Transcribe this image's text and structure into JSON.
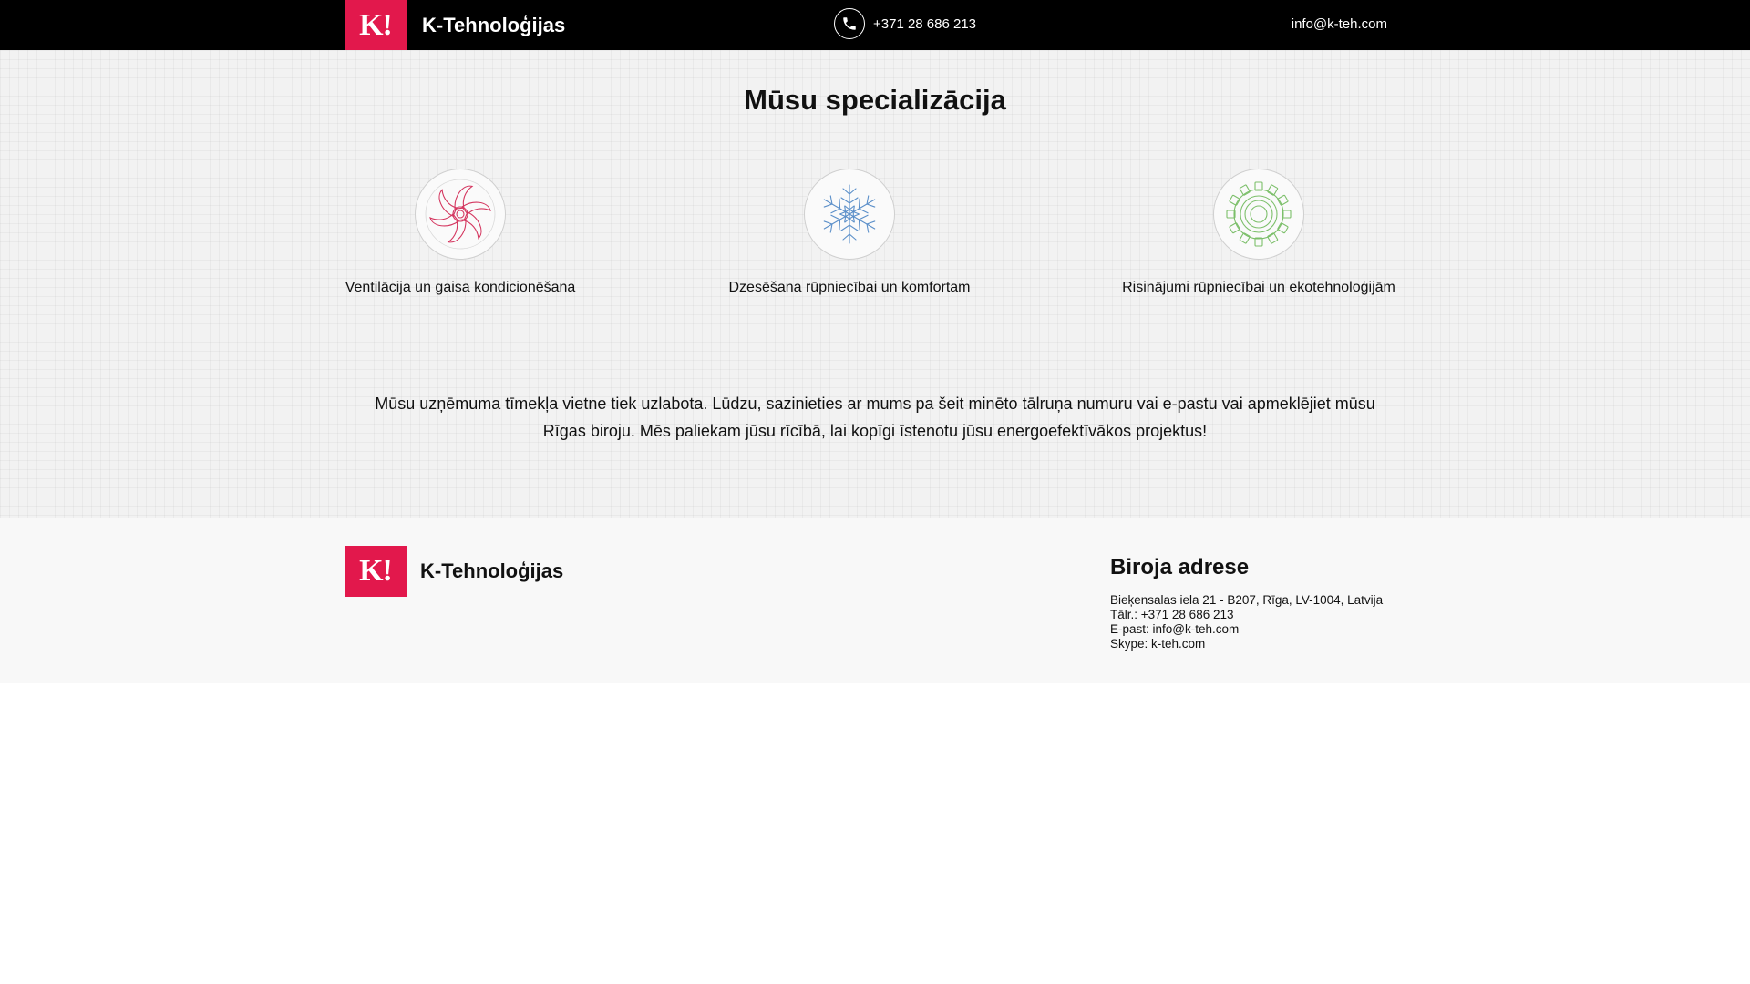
{
  "header": {
    "logo_text": "K!",
    "brand": "K-Tehnoloģijas",
    "phone": "+371 28 686 213",
    "email": "info@k-teh.com"
  },
  "main": {
    "title": "Mūsu specializācija",
    "specializations": [
      {
        "label": "Ventilācija un gaisa kondicionēšana",
        "icon": "fan-icon",
        "color": "#d4365f"
      },
      {
        "label": "Dzesēšana rūpniecībai un komfortam",
        "icon": "snowflake-icon",
        "color": "#5b8fc9"
      },
      {
        "label": "Risinājumi rūpniecībai un ekotehnoloģijām",
        "icon": "gear-icon",
        "color": "#7cbf6a"
      }
    ],
    "intro": "Mūsu uzņēmuma tīmekļa vietne tiek uzlabota. Lūdzu, sazinieties ar mums pa šeit minēto tālruņa numuru vai e-pastu vai apmeklējiet mūsu Rīgas biroju. Mēs paliekam jūsu rīcībā, lai kopīgi īstenotu jūsu energoefektīvākos projektus!"
  },
  "footer": {
    "logo_text": "K!",
    "brand": "K-Tehnoloģijas",
    "address_title": "Biroja adrese",
    "lines": [
      "Bieķensalas iela 21 - B207, Rīga, LV-1004, Latvija",
      "Tālr.: +371 28 686 213",
      "E-past: info@k-teh.com",
      "Skype: k-teh.com"
    ]
  },
  "colors": {
    "brand_red": "#e2184c",
    "header_bg": "#000000",
    "fan": "#d4365f",
    "snowflake": "#5b8fc9",
    "gear": "#7cbf6a"
  }
}
